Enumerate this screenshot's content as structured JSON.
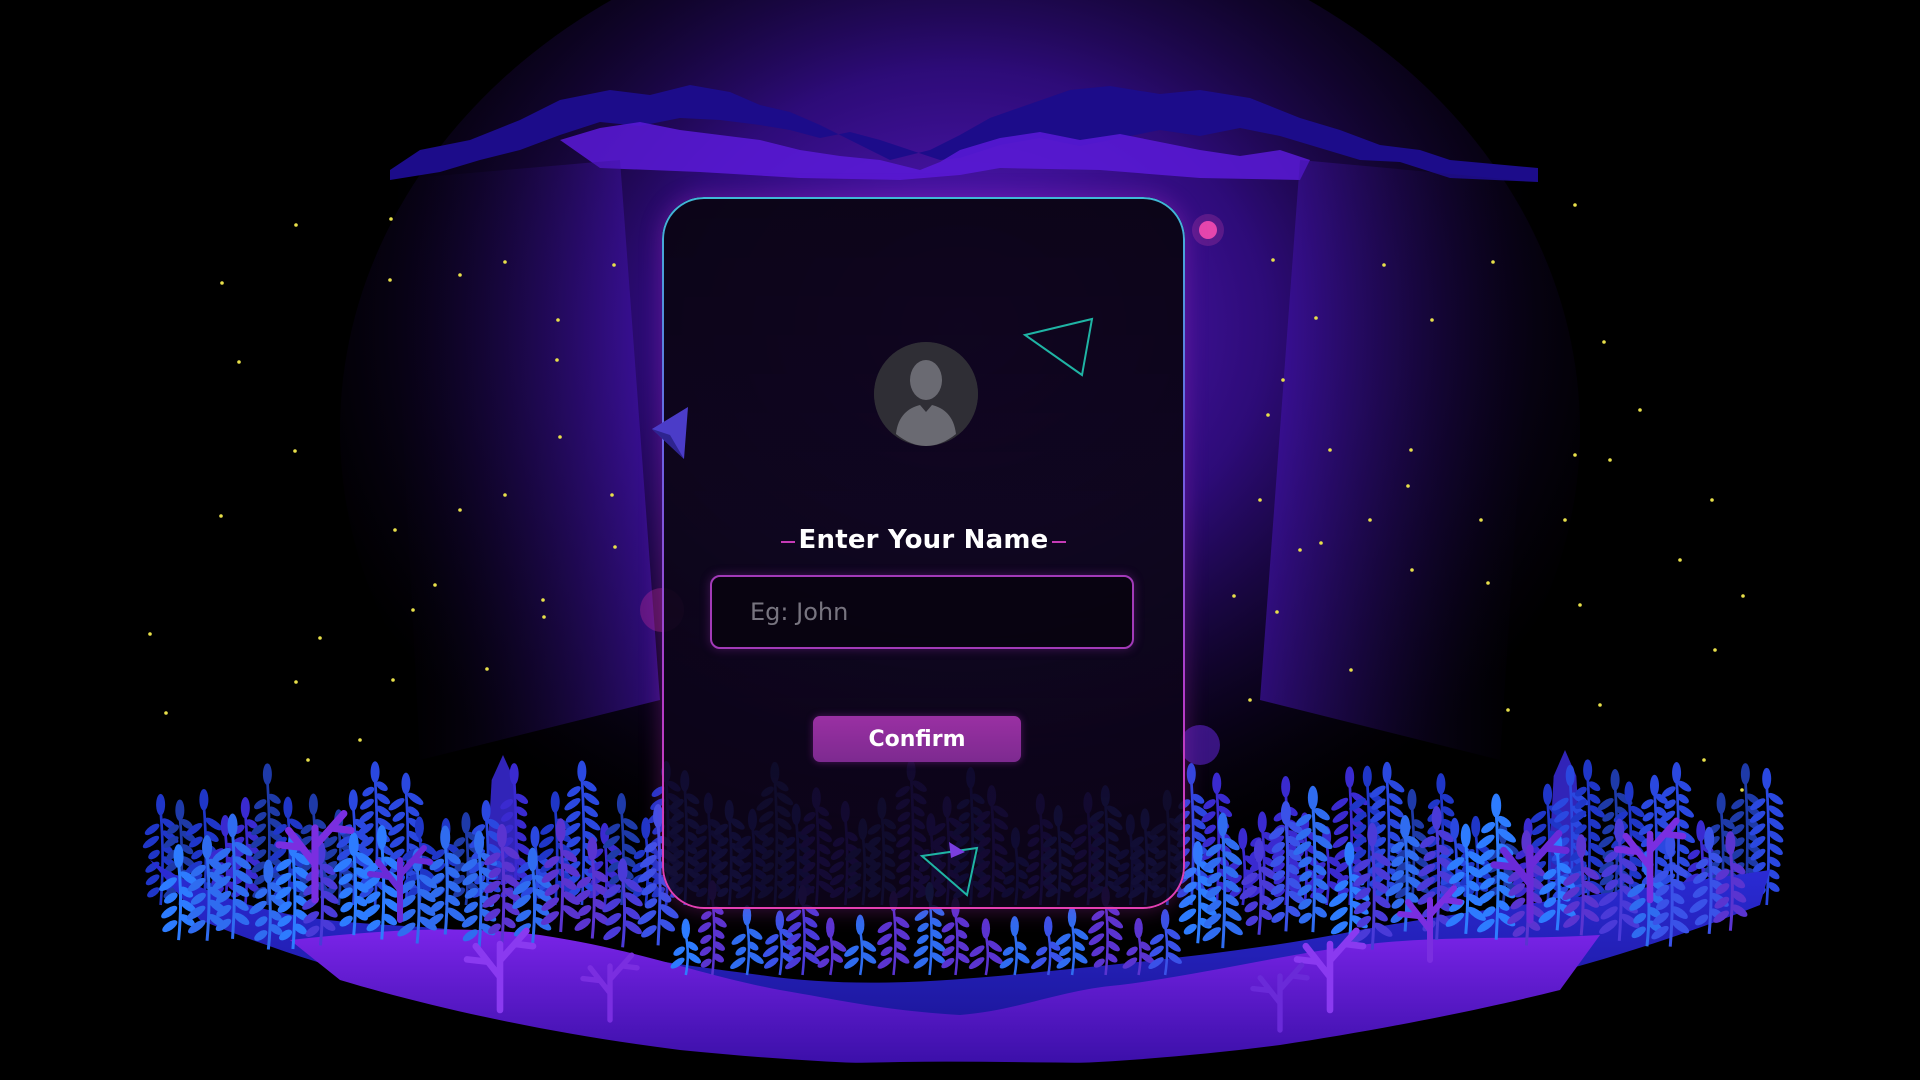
{
  "form": {
    "title": "Enter Your Name",
    "input_placeholder": "Eg: John",
    "input_value": "",
    "confirm_label": "Confirm"
  },
  "icons": {
    "avatar": "user-silhouette-icon"
  },
  "colors": {
    "background": "#000000",
    "card_border_top": "#3fb9d6",
    "card_border_bottom": "#e43fb2",
    "input_border": "#a23ab8",
    "button": "#8a2c9a",
    "glow": "#6a1fd9",
    "star": "#e8e04a"
  }
}
